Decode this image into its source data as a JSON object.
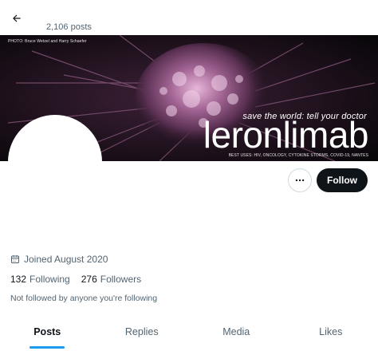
{
  "header": {
    "posts_count": "2,106 posts",
    "back_icon": "arrow-left-icon"
  },
  "banner": {
    "photo_credit": "PHOTO: Bruce Wetzel and Harry Schaefer",
    "tagline": "save the world: tell your doctor",
    "brand": "leronlimab",
    "footer": "BEST USES: HIV, ONCOLOGY, CYTOKINE STORMS, COVID-19, NANTES"
  },
  "profile": {
    "joined": "Joined August 2020",
    "following_count": "132",
    "following_label": "Following",
    "followers_count": "276",
    "followers_label": "Followers",
    "not_followed": "Not followed by anyone you're following"
  },
  "actions": {
    "more_icon": "more-horizontal-icon",
    "follow_label": "Follow"
  },
  "tabs": [
    {
      "label": "Posts",
      "active": true
    },
    {
      "label": "Replies",
      "active": false
    },
    {
      "label": "Media",
      "active": false
    },
    {
      "label": "Likes",
      "active": false
    }
  ],
  "colors": {
    "accent": "#1d9bf0",
    "text_primary": "#0f1419",
    "text_secondary": "#536471",
    "follow_button": "#0f1419"
  }
}
